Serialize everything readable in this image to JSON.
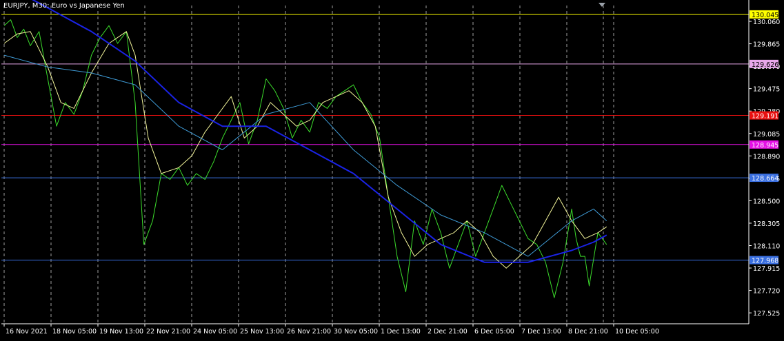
{
  "window": {
    "title": "EURJPY, M30:  Euro vs Japanese Yen"
  },
  "colors": {
    "background": "#000000",
    "grid": "#c8c8c8",
    "axis": "#ffffff",
    "price_line": "#3bdc2b",
    "ma_fast": "#f3f59a",
    "ma_mid": "#3f9bd6",
    "ma_slow": "#1a23e6"
  },
  "chart_data": {
    "type": "line",
    "symbol": "EURJPY",
    "timeframe": "M30",
    "description": "Euro vs Japanese Yen",
    "ylim": [
      127.43,
      130.12
    ],
    "grid": true,
    "x_ticks": [
      "16 Nov 2021",
      "18 Nov 05:00",
      "19 Nov 13:00",
      "22 Nov 21:00",
      "24 Nov 05:00",
      "25 Nov 13:00",
      "26 Nov 21:00",
      "30 Nov 05:00",
      "1 Dec 13:00",
      "2 Dec 21:00",
      "6 Dec 05:00",
      "7 Dec 13:00",
      "8 Dec 21:00",
      "10 Dec 05:00"
    ],
    "y_ticks": [
      "130.060",
      "129.865",
      "129.670",
      "129.475",
      "129.280",
      "129.085",
      "128.890",
      "128.695",
      "128.500",
      "128.305",
      "128.110",
      "127.915",
      "127.720",
      "127.525"
    ],
    "horizontal_levels": [
      {
        "label": "130.045",
        "value": 130.045,
        "color": "#ffff00",
        "label_bg": "#ffff00",
        "label_fg": "#000000"
      },
      {
        "label": "129.626",
        "value": 129.626,
        "color": "#e8a8ea",
        "label_bg": "#e8a8ea",
        "label_fg": "#000000"
      },
      {
        "label": "129.191",
        "value": 129.191,
        "color": "#e81010",
        "label_bg": "#e81010",
        "label_fg": "#ffffff"
      },
      {
        "label": "128.945",
        "value": 128.945,
        "color": "#e610e6",
        "label_bg": "#e610e6",
        "label_fg": "#ffffff"
      },
      {
        "label": "128.664",
        "value": 128.664,
        "color": "#3a6fe0",
        "label_bg": "#3a6fe0",
        "label_fg": "#ffffff"
      },
      {
        "label": "127.968",
        "value": 127.968,
        "color": "#3a6fe0",
        "label_bg": "#3a6fe0",
        "label_fg": "#ffffff"
      }
    ],
    "series": [
      {
        "key": "price",
        "color": "#3bdc2b",
        "width": 1,
        "x": [
          0,
          0.15,
          0.3,
          0.45,
          0.6,
          0.8,
          1.0,
          1.2,
          1.4,
          1.6,
          1.8,
          2.0,
          2.2,
          2.4,
          2.6,
          2.8,
          3.0,
          3.2,
          3.4,
          3.6,
          3.8,
          4.0,
          4.2,
          4.4,
          4.6,
          4.8,
          5.0,
          5.2,
          5.4,
          5.6,
          5.8,
          6.0,
          6.2,
          6.4,
          6.6,
          6.8,
          7.0,
          7.2,
          7.4,
          7.6,
          7.8,
          8.0,
          8.2,
          8.4,
          8.6,
          8.8,
          9.0,
          9.2,
          9.4,
          9.6,
          9.8,
          10.0,
          10.2,
          10.4,
          10.6,
          10.8,
          11.0,
          11.2,
          11.4,
          11.6,
          11.8,
          12.0,
          12.2,
          12.4,
          12.6,
          12.8,
          13.0,
          13.1,
          13.2,
          13.3,
          13.4,
          13.6,
          13.8
        ],
        "y": [
          129.95,
          130.0,
          129.85,
          129.92,
          129.78,
          129.9,
          129.5,
          129.1,
          129.3,
          129.2,
          129.4,
          129.7,
          129.85,
          129.95,
          129.8,
          129.9,
          129.3,
          128.1,
          128.3,
          128.7,
          128.65,
          128.75,
          128.6,
          128.7,
          128.65,
          128.8,
          129.0,
          129.15,
          129.3,
          128.95,
          129.15,
          129.5,
          129.4,
          129.25,
          129.0,
          129.15,
          129.05,
          129.3,
          129.25,
          129.35,
          129.4,
          129.45,
          129.3,
          129.2,
          129.0,
          128.5,
          128.0,
          127.7,
          128.3,
          128.1,
          128.4,
          128.2,
          127.9,
          128.1,
          128.3,
          128.0,
          128.2,
          128.4,
          128.6,
          128.45,
          128.3,
          128.15,
          128.1,
          127.95,
          127.65,
          127.95,
          128.4,
          128.15,
          128.0,
          128.0,
          127.75,
          128.2,
          128.1
        ]
      },
      {
        "key": "ma_fast",
        "color": "#f3f59a",
        "width": 1,
        "x": [
          0,
          0.3,
          0.6,
          1.0,
          1.3,
          1.6,
          2.0,
          2.4,
          2.8,
          3.0,
          3.3,
          3.6,
          4.0,
          4.3,
          4.6,
          4.9,
          5.2,
          5.5,
          5.8,
          6.1,
          6.4,
          6.7,
          7.0,
          7.3,
          7.6,
          7.9,
          8.2,
          8.5,
          8.8,
          9.1,
          9.4,
          9.7,
          10.0,
          10.3,
          10.6,
          10.9,
          11.2,
          11.5,
          11.8,
          12.1,
          12.4,
          12.7,
          13.0,
          13.3,
          13.6,
          13.8
        ],
        "y": [
          129.8,
          129.88,
          129.9,
          129.6,
          129.3,
          129.25,
          129.55,
          129.8,
          129.9,
          129.7,
          129.0,
          128.7,
          128.75,
          128.85,
          129.05,
          129.2,
          129.35,
          129.0,
          129.1,
          129.3,
          129.2,
          129.1,
          129.15,
          129.3,
          129.35,
          129.4,
          129.3,
          129.1,
          128.5,
          128.2,
          128.0,
          128.1,
          128.15,
          128.2,
          128.3,
          128.2,
          128.0,
          127.9,
          128.0,
          128.1,
          128.3,
          128.5,
          128.3,
          128.15,
          128.2,
          128.25
        ]
      },
      {
        "key": "ma_mid",
        "color": "#3f9bd6",
        "width": 1,
        "x": [
          0,
          1.0,
          2.0,
          3.0,
          4.0,
          5.0,
          6.0,
          7.0,
          8.0,
          9.0,
          10.0,
          11.0,
          12.0,
          13.0,
          13.5,
          13.8
        ],
        "y": [
          129.7,
          129.6,
          129.55,
          129.45,
          129.1,
          128.9,
          129.2,
          129.3,
          128.9,
          128.6,
          128.35,
          128.2,
          128.0,
          128.3,
          128.4,
          128.3
        ]
      },
      {
        "key": "ma_slow",
        "color": "#1a23e6",
        "width": 2,
        "x": [
          0,
          1.0,
          2.0,
          3.0,
          4.0,
          5.0,
          6.0,
          7.0,
          8.0,
          9.0,
          10.0,
          11.0,
          12.0,
          13.0,
          13.5,
          13.8
        ],
        "y": [
          130.3,
          130.1,
          129.9,
          129.65,
          129.3,
          129.1,
          129.1,
          128.9,
          128.7,
          128.4,
          128.1,
          127.95,
          127.95,
          128.05,
          128.12,
          128.18
        ]
      }
    ]
  }
}
